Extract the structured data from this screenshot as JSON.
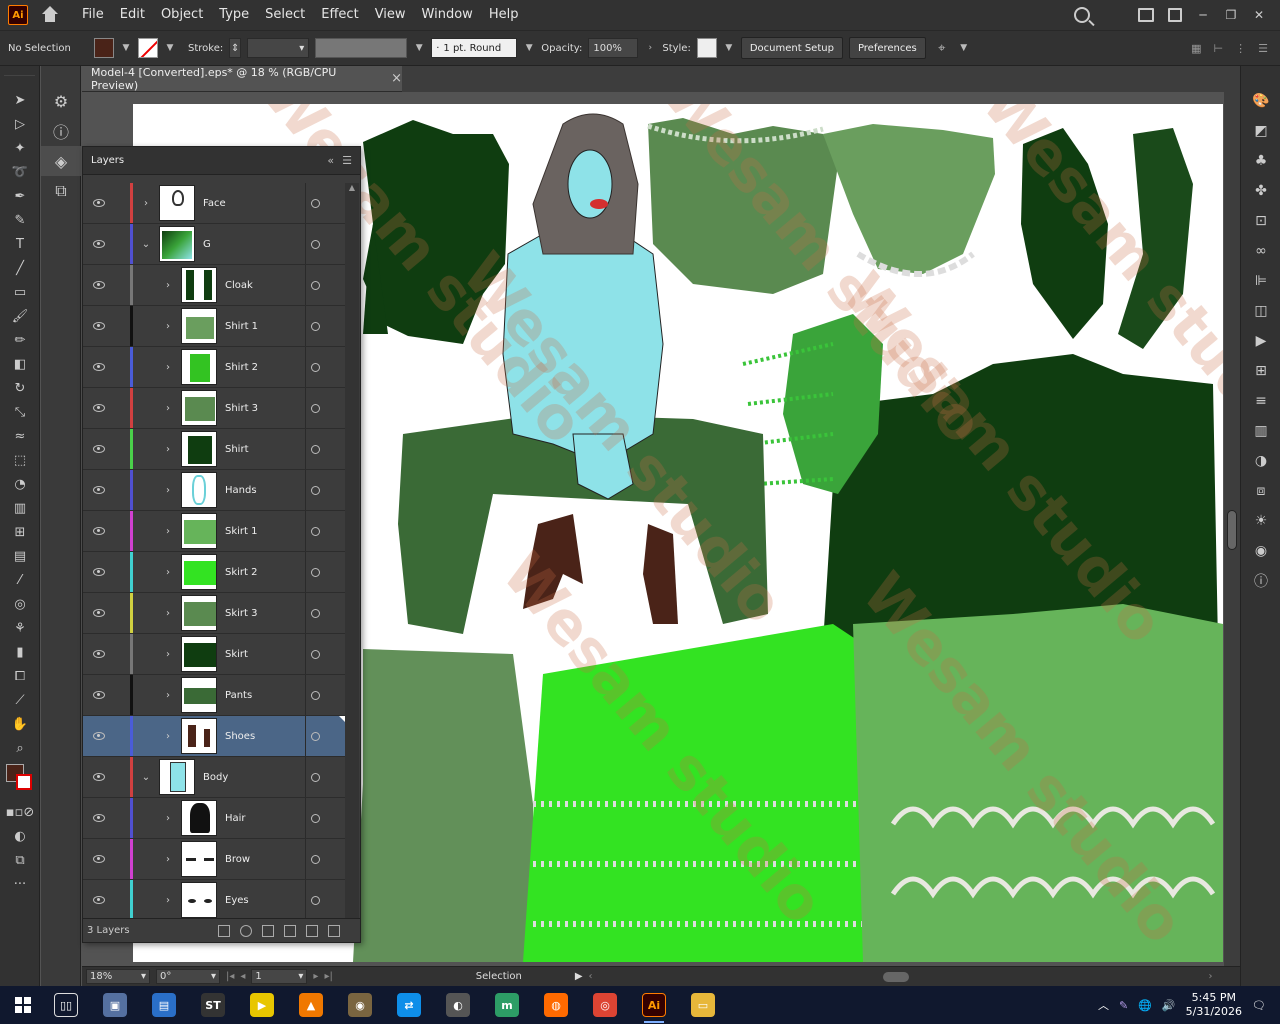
{
  "app": {
    "logo": "Ai"
  },
  "menu": [
    "File",
    "Edit",
    "Object",
    "Type",
    "Select",
    "Effect",
    "View",
    "Window",
    "Help"
  ],
  "control": {
    "selection_state": "No Selection",
    "fill_color": "#4a2318",
    "stroke_label": "Stroke:",
    "stroke_profile": "1 pt. Round",
    "opacity_label": "Opacity:",
    "opacity_value": "100%",
    "style_label": "Style:",
    "doc_setup_label": "Document Setup",
    "preferences_label": "Preferences"
  },
  "document": {
    "tab_title": "Model-4 [Converted].eps* @ 18 % (RGB/CPU Preview)",
    "close_glyph": "×"
  },
  "layers_panel": {
    "title": "Layers",
    "footer_count": "3 Layers",
    "rows": [
      {
        "name": "Face",
        "color": "#d04040",
        "indent": 0,
        "expanded": false,
        "thumb": "face"
      },
      {
        "name": "G",
        "color": "#5050d0",
        "indent": 0,
        "expanded": true,
        "thumb": "g"
      },
      {
        "name": "Cloak",
        "color": "#777777",
        "indent": 1,
        "expanded": false,
        "thumb": "cloak"
      },
      {
        "name": "Shirt 1",
        "color": "#111111",
        "indent": 1,
        "expanded": false,
        "thumb": "shirt1"
      },
      {
        "name": "Shirt 2",
        "color": "#4a5cd8",
        "indent": 1,
        "expanded": false,
        "thumb": "shirt2"
      },
      {
        "name": "Shirt 3",
        "color": "#d04040",
        "indent": 1,
        "expanded": false,
        "thumb": "shirt3"
      },
      {
        "name": "Shirt",
        "color": "#4ad04a",
        "indent": 1,
        "expanded": false,
        "thumb": "shirt"
      },
      {
        "name": "Hands",
        "color": "#5050d0",
        "indent": 1,
        "expanded": false,
        "thumb": "hands"
      },
      {
        "name": "Skirt 1",
        "color": "#d040d0",
        "indent": 1,
        "expanded": false,
        "thumb": "skirt1"
      },
      {
        "name": "Skirt 2",
        "color": "#40d0d0",
        "indent": 1,
        "expanded": false,
        "thumb": "skirt2"
      },
      {
        "name": "Skirt 3",
        "color": "#d0d040",
        "indent": 1,
        "expanded": false,
        "thumb": "skirt3"
      },
      {
        "name": "Skirt",
        "color": "#777777",
        "indent": 1,
        "expanded": false,
        "thumb": "skirt"
      },
      {
        "name": "Pants",
        "color": "#111111",
        "indent": 1,
        "expanded": false,
        "thumb": "pants"
      },
      {
        "name": "Shoes",
        "color": "#4a5cd8",
        "indent": 1,
        "expanded": false,
        "selected": true,
        "thumb": "shoes"
      },
      {
        "name": "Body",
        "color": "#d04040",
        "indent": 0,
        "expanded": true,
        "thumb": "body"
      },
      {
        "name": "Hair",
        "color": "#5050d0",
        "indent": 1,
        "expanded": false,
        "thumb": "hair"
      },
      {
        "name": "Brow",
        "color": "#d040d0",
        "indent": 1,
        "expanded": false,
        "thumb": "brow"
      },
      {
        "name": "Eyes",
        "color": "#40d0d0",
        "indent": 1,
        "expanded": false,
        "thumb": "eyes"
      }
    ]
  },
  "status": {
    "zoom": "18%",
    "rotation": "0°",
    "artboard_number": "1",
    "tool_status": "Selection"
  },
  "watermark": "Wesam studio",
  "taskbar": {
    "time": "5:45 PM",
    "date": "5/31/2026",
    "apps": [
      {
        "name": "task-view",
        "glyph": "▯▯",
        "bg": "transparent"
      },
      {
        "name": "vm-app",
        "glyph": "▣",
        "bg": "#5570a0"
      },
      {
        "name": "scanner-app",
        "glyph": "▤",
        "bg": "#2a6fc8"
      },
      {
        "name": "studio-app",
        "glyph": "ST",
        "bg": "#333333"
      },
      {
        "name": "player-app",
        "glyph": "▶",
        "bg": "#e8c600"
      },
      {
        "name": "vlc-app",
        "glyph": "▲",
        "bg": "#f07800"
      },
      {
        "name": "gimp-app",
        "glyph": "◉",
        "bg": "#7a6540"
      },
      {
        "name": "teamviewer-app",
        "glyph": "⇄",
        "bg": "#0e8ee9"
      },
      {
        "name": "blender-app",
        "glyph": "◐",
        "bg": "#555555"
      },
      {
        "name": "mint-app",
        "glyph": "m",
        "bg": "#2d9d66"
      },
      {
        "name": "firefox-app",
        "glyph": "◍",
        "bg": "#ff6a00"
      },
      {
        "name": "chrome-app",
        "glyph": "◎",
        "bg": "#dd4433"
      },
      {
        "name": "illustrator-app",
        "glyph": "Ai",
        "bg": "#330000",
        "active": true
      },
      {
        "name": "explorer-app",
        "glyph": "▭",
        "bg": "#e7b73a"
      }
    ]
  }
}
